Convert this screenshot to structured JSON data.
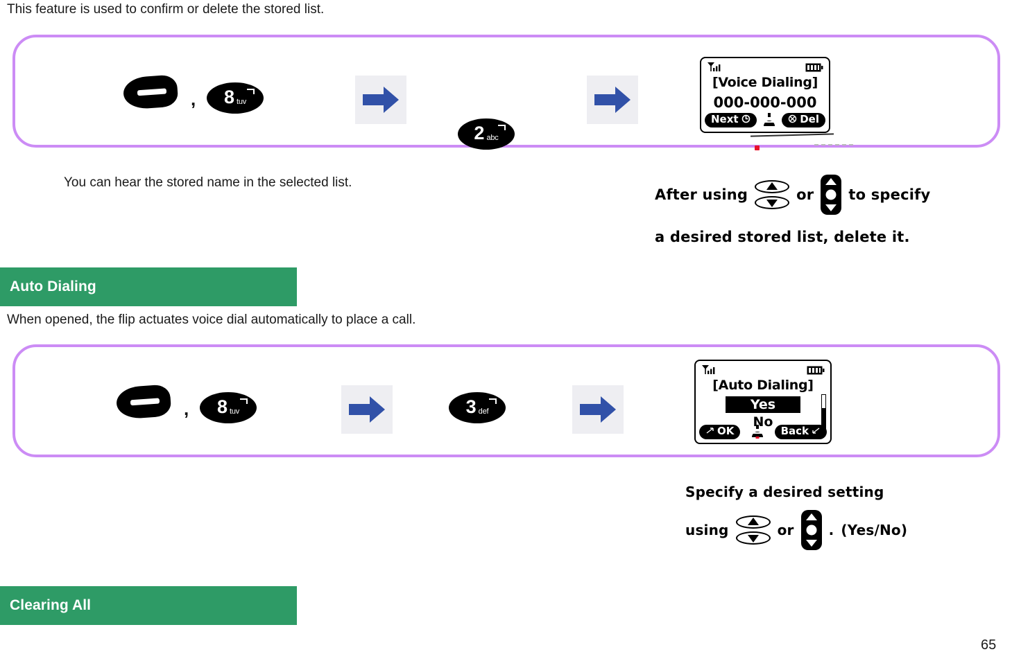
{
  "page": {
    "number": "65",
    "accent_green": "#2E9B66",
    "accent_purple": "#CC8CF5",
    "arrow_blue": "#3151A8",
    "artifact_red": "#E8122A"
  },
  "intro_text": "This feature is used to confirm or delete the stored list.",
  "step_box_1": {
    "keys": {
      "send_key_name": "send-key",
      "comma": ",",
      "digit_key_1": {
        "digit": "8",
        "letters": "tuv"
      },
      "digit_key_2": {
        "digit": "2",
        "letters": "abc"
      }
    },
    "arrow_label": "next-step-arrow",
    "screen": {
      "title": "[Voice Dialing]",
      "number": "000-000-000",
      "softkey_left": "Next",
      "softkey_right": "Del",
      "status_signal": "signal-bars-icon",
      "status_battery": "battery-icon"
    }
  },
  "note_1": "You can hear the stored name in the selected list.",
  "annotation_1": {
    "line1_part1": "After using",
    "line1_or": "or",
    "line1_part2": "to specify",
    "line2": "a desired  stored list, delete it."
  },
  "section_auto_dialing": {
    "title": "Auto Dialing",
    "description": "When opened, the flip actuates voice dial automatically to place a call."
  },
  "step_box_2": {
    "keys": {
      "send_key_name": "send-key",
      "comma": ",",
      "digit_key_1": {
        "digit": "8",
        "letters": "tuv"
      },
      "digit_key_2": {
        "digit": "3",
        "letters": "def"
      }
    },
    "arrow_label": "next-step-arrow",
    "screen": {
      "title": "[Auto Dialing]",
      "option_selected": "Yes",
      "option_other": "No",
      "softkey_left": "OK",
      "softkey_right": "Back",
      "status_signal": "signal-bars-icon",
      "status_battery": "battery-icon"
    }
  },
  "annotation_2": {
    "line1": "Specify a desired setting",
    "line2_part1": "using",
    "line2_or": "or",
    "line2_period": ".",
    "line2_part2": "(Yes/No)"
  },
  "section_clearing_all": {
    "title": "Clearing All"
  }
}
